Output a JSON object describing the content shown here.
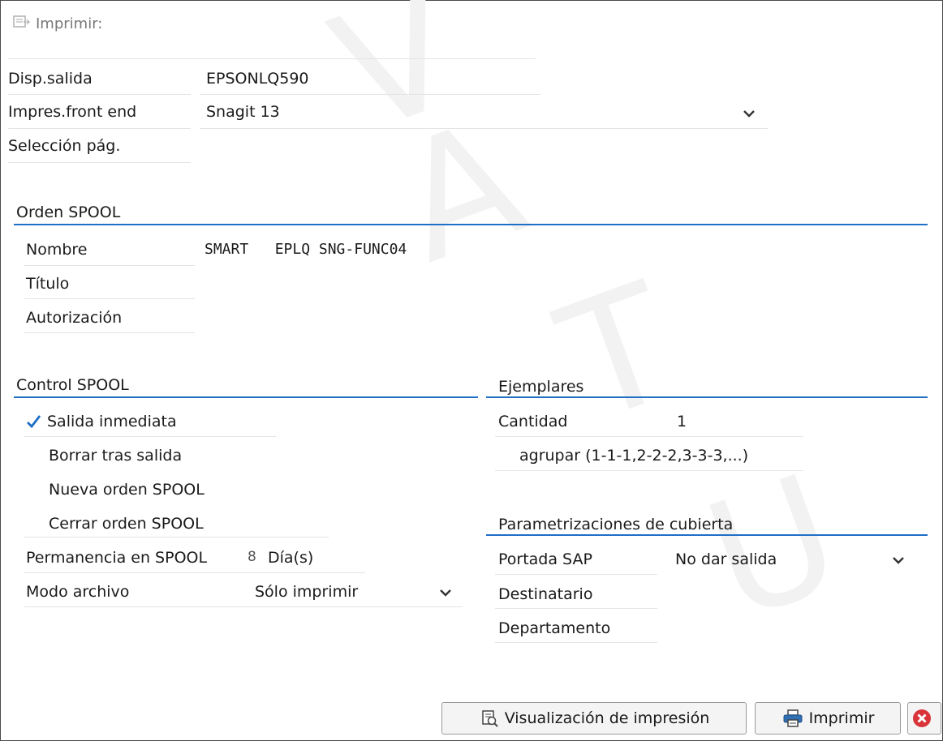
{
  "dialog": {
    "title": "Imprimir:",
    "title_icon": "print-doc-icon"
  },
  "output": {
    "device_label": "Disp.salida",
    "device_value": "EPSONLQ590",
    "frontend_label": "Impres.front end",
    "frontend_value": "Snagit 13",
    "page_sel_label": "Selección pág."
  },
  "spool_order": {
    "heading": "Orden SPOOL",
    "name_label": "Nombre",
    "name_value": "SMART   EPLQ SNG-FUNC04",
    "title_label": "Título",
    "auth_label": "Autorización"
  },
  "spool_control": {
    "heading": "Control SPOOL",
    "immediate_output": "Salida inmediata",
    "immediate_checked": true,
    "delete_after": "Borrar tras salida",
    "new_request": "Nueva orden SPOOL",
    "close_request": "Cerrar orden SPOOL",
    "retention_label": "Permanencia en SPOOL",
    "retention_value": "8",
    "retention_unit": "Día(s)",
    "archive_label": "Modo archivo",
    "archive_value": "Sólo imprimir"
  },
  "copies": {
    "heading": "Ejemplares",
    "quantity_label": "Cantidad",
    "quantity_value": "1",
    "collate_label": "agrupar (1-1-1,2-2-2,3-3-3,...)"
  },
  "cover": {
    "heading": "Parametrizaciones de cubierta",
    "sap_cover_label": "Portada SAP",
    "sap_cover_value": "No dar salida",
    "recipient_label": "Destinatario",
    "department_label": "Departamento"
  },
  "buttons": {
    "preview": "Visualización de impresión",
    "print": "Imprimir"
  },
  "colors": {
    "accent": "#1f6fc7",
    "check": "#1f6fc7",
    "cancel": "#d9343a"
  }
}
